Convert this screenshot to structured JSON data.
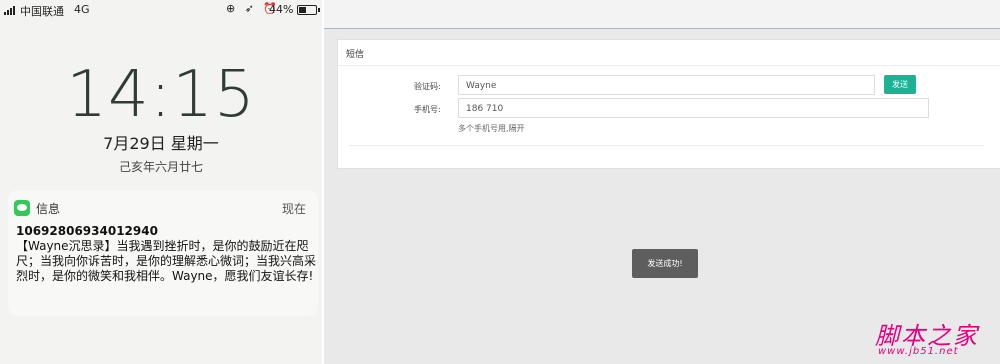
{
  "phone": {
    "status": {
      "carrier": "中国联通",
      "network": "4G",
      "icons": "⊕ ➶ ⏰",
      "battery": "44%",
      "battery_level": 0.44
    },
    "time": "14:15",
    "date": "7月29日 星期一",
    "lunar": "己亥年六月廿七",
    "notification": {
      "app": "信息",
      "when": "现在",
      "sender": "10692806934012940",
      "body": "【Wayne沉思录】当我遇到挫折时，是你的鼓励近在咫尺；当我向你诉苦时，是你的理解悉心微词；当我兴高采烈时，是你的微笑和我相伴。Wayne，愿我们友谊长存!"
    }
  },
  "web": {
    "card_title": "短信",
    "code_label": "验证码:",
    "code_value": "Wayne",
    "send_button": "发送",
    "phone_label": "手机号:",
    "phone_value": "186        710",
    "hint": "多个手机号用,隔开",
    "toast": "发送成功!"
  },
  "watermark": {
    "title": "脚本之家",
    "url": "www.jb51.net"
  },
  "colors": {
    "accent": "#1ab394",
    "watermark": "#e4007f",
    "toast_bg": "#5e5e5e"
  }
}
